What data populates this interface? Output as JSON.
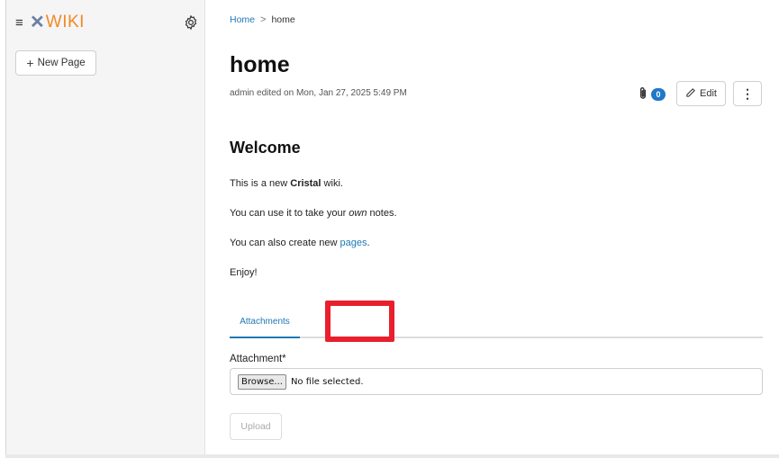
{
  "sidebar": {
    "menu_icon": "hamburger-icon",
    "logo_mark": "✕",
    "logo_text": "WIKI",
    "settings_icon": "gear-icon",
    "new_page_label": "New Page"
  },
  "breadcrumb": {
    "home_label": "Home",
    "separator": ">",
    "current_label": "home"
  },
  "page": {
    "title": "home",
    "meta": "admin edited on Mon, Jan 27, 2025 5:49 PM",
    "attachment_count": "0",
    "edit_label": "Edit",
    "more_label": "⋮"
  },
  "content": {
    "heading": "Welcome",
    "p1_before": "This is a new ",
    "p1_bold": "Cristal",
    "p1_after": " wiki.",
    "p2_before": "You can use it to take your ",
    "p2_em": "own",
    "p2_after": " notes.",
    "p3_before": "You can also create new ",
    "p3_link": "pages",
    "p3_after": ".",
    "p4": "Enjoy!"
  },
  "tabs": {
    "attachments_label": "Attachments"
  },
  "form": {
    "attachment_label": "Attachment",
    "required_mark": "*",
    "browse_label": "Browse...",
    "no_file_text": "No file selected.",
    "upload_label": "Upload"
  },
  "colors": {
    "accent": "#1f78b4",
    "logo_orange": "#f08a24",
    "highlight_red": "#e8202d"
  }
}
